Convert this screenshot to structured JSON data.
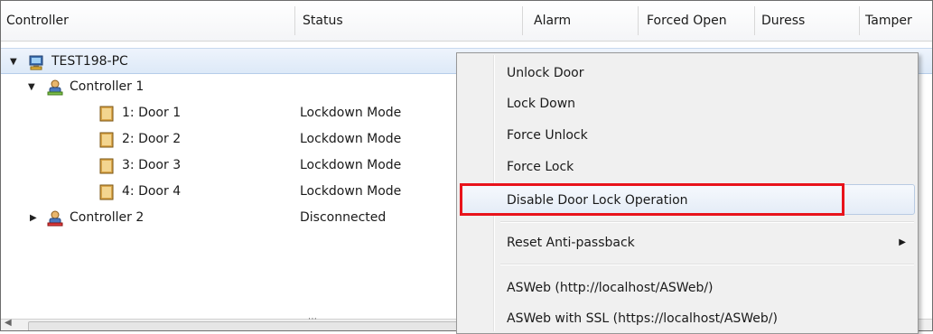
{
  "columns": [
    "Controller",
    "Status",
    "Alarm",
    "Forced Open",
    "Duress",
    "Tamper"
  ],
  "tree": {
    "root": {
      "label": "TEST198-PC",
      "expanded": true
    },
    "controller1": {
      "label": "Controller 1",
      "expanded": true
    },
    "doors": [
      {
        "label": "1: Door 1",
        "status": "Lockdown Mode"
      },
      {
        "label": "2: Door 2",
        "status": "Lockdown Mode"
      },
      {
        "label": "3: Door 3",
        "status": "Lockdown Mode"
      },
      {
        "label": "4: Door 4",
        "status": "Lockdown Mode"
      }
    ],
    "controller2": {
      "label": "Controller 2",
      "status": "Disconnected",
      "expanded": false
    }
  },
  "context_menu": {
    "items": [
      "Unlock Door",
      "Lock Down",
      "Force Unlock",
      "Force Lock",
      "Disable Door Lock Operation",
      "Reset Anti-passback",
      "ASWeb (http://localhost/ASWeb/)",
      "ASWeb with SSL (https://localhost/ASWeb/)"
    ],
    "highlighted_item": "Disable Door Lock Operation",
    "submenu_item": "Reset Anti-passback"
  },
  "colors": {
    "highlight_box": "#e8131b",
    "selection": "#dde9f8",
    "menu_background": "#f0f0f0"
  },
  "icons": [
    "computer-icon",
    "controller-icon",
    "door-icon",
    "controller-disconnected-icon"
  ]
}
